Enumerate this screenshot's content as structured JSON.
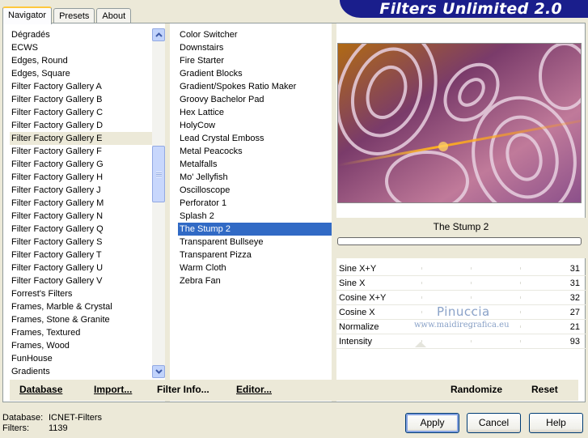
{
  "app": {
    "title": "Filters Unlimited 2.0"
  },
  "tabs": [
    {
      "label": "Navigator"
    },
    {
      "label": "Presets"
    },
    {
      "label": "About"
    }
  ],
  "categories": [
    "Dégradés",
    "ECWS",
    "Edges, Round",
    "Edges, Square",
    "Filter Factory Gallery A",
    "Filter Factory Gallery B",
    "Filter Factory Gallery C",
    "Filter Factory Gallery D",
    "Filter Factory Gallery E",
    "Filter Factory Gallery F",
    "Filter Factory Gallery G",
    "Filter Factory Gallery H",
    "Filter Factory Gallery J",
    "Filter Factory Gallery M",
    "Filter Factory Gallery N",
    "Filter Factory Gallery Q",
    "Filter Factory Gallery S",
    "Filter Factory Gallery T",
    "Filter Factory Gallery U",
    "Filter Factory Gallery V",
    "Forrest's Filters",
    "Frames, Marble & Crystal",
    "Frames, Stone & Granite",
    "Frames, Textured",
    "Frames, Wood",
    "FunHouse",
    "Gradients"
  ],
  "selected_category": "Filter Factory Gallery E",
  "filters": [
    "Color Switcher",
    "Downstairs",
    "Fire Starter",
    "Gradient Blocks",
    "Gradient/Spokes Ratio Maker",
    "Groovy Bachelor Pad",
    "Hex Lattice",
    "HolyCow",
    "Lead Crystal Emboss",
    "Metal Peacocks",
    "Metalfalls",
    "Mo' Jellyfish",
    "Oscilloscope",
    "Perforator 1",
    "Splash 2",
    "The Stump 2",
    "Transparent Bullseye",
    "Transparent Pizza",
    "Warm Cloth",
    "Zebra Fan"
  ],
  "selected_filter": "The Stump 2",
  "preview": {
    "filter_name": "The Stump 2"
  },
  "params": [
    {
      "label": "Sine X+Y",
      "value": "31"
    },
    {
      "label": "Sine X",
      "value": "31"
    },
    {
      "label": "Cosine X+Y",
      "value": "32"
    },
    {
      "label": "Cosine X",
      "value": "27"
    },
    {
      "label": "Normalize",
      "value": "21"
    },
    {
      "label": "Intensity",
      "value": "93"
    }
  ],
  "watermark": {
    "name": "Pinuccia",
    "site": "www.maidiregrafica.eu"
  },
  "bottom_buttons": {
    "database": "Database",
    "import": "Import...",
    "filter_info": "Filter Info...",
    "editor": "Editor...",
    "randomize": "Randomize",
    "reset": "Reset"
  },
  "footer": {
    "database_label": "Database:",
    "database_value": "ICNET-Filters",
    "filters_label": "Filters:",
    "filters_value": "1139"
  },
  "dialog_buttons": {
    "apply": "Apply",
    "cancel": "Cancel",
    "help": "Help"
  },
  "colors": {
    "banner": "#1a1e8c",
    "selection": "#316ac5",
    "tab_highlight": "#ffc83c"
  }
}
